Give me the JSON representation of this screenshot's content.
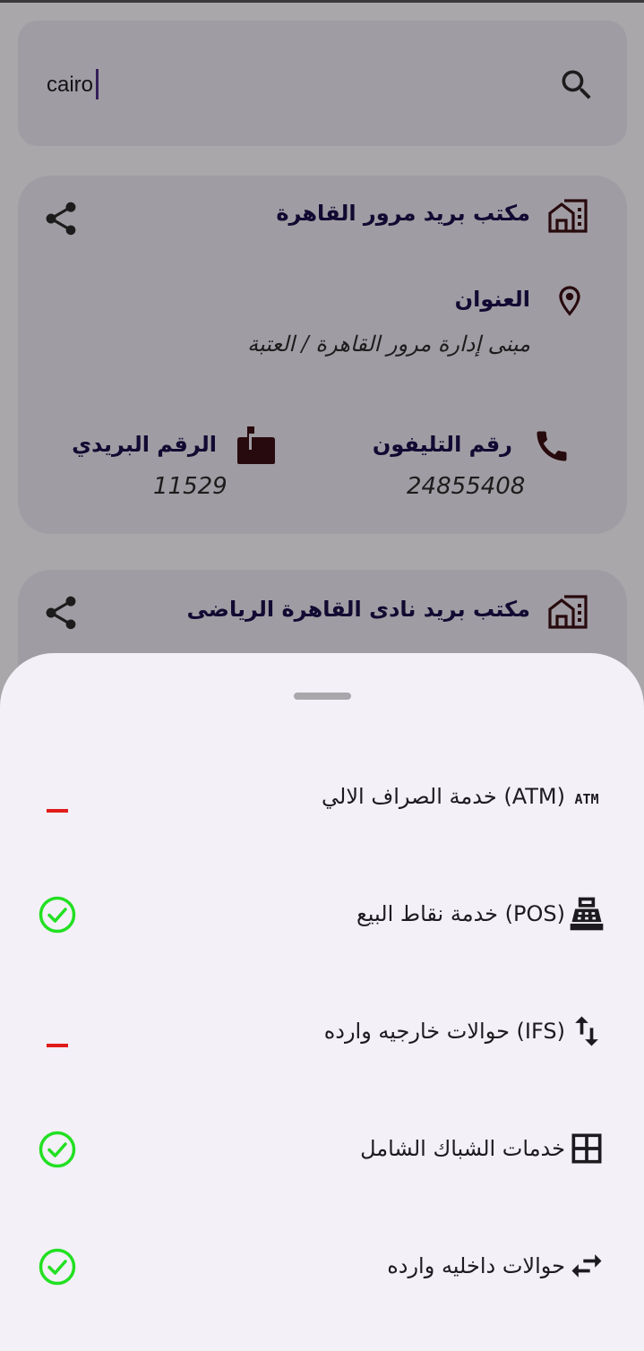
{
  "search": {
    "value": "cairo",
    "icon": "search-icon"
  },
  "offices": [
    {
      "name": "مكتب بريد مرور القاهرة",
      "address_label": "العنوان",
      "address": "مبنى إدارة مرور القاهرة / العتبة",
      "phone_label": "رقم التليفون",
      "phone": "24855408",
      "postal_label": "الرقم البريدي",
      "postal_code": "11529"
    },
    {
      "name": "مكتب بريد نادى القاهرة الرياضى"
    }
  ],
  "services": [
    {
      "label": "(ATM) خدمة الصراف الالي",
      "icon": "atm-icon",
      "available": false
    },
    {
      "label": "(POS) خدمة نقاط البيع",
      "icon": "pos-register-icon",
      "available": true
    },
    {
      "label": "(IFS) حوالات خارجيه وارده",
      "icon": "swap-vertical-icon",
      "available": false
    },
    {
      "label": "خدمات الشباك الشامل",
      "icon": "grid-icon",
      "available": true
    },
    {
      "label": "حوالات داخليه وارده",
      "icon": "swap-horizontal-icon",
      "available": true
    }
  ],
  "colors": {
    "available": "#22e022",
    "unavailable": "#e01b1b",
    "title": "#1a0f4a",
    "icon_dark": "#2b0a0a"
  }
}
